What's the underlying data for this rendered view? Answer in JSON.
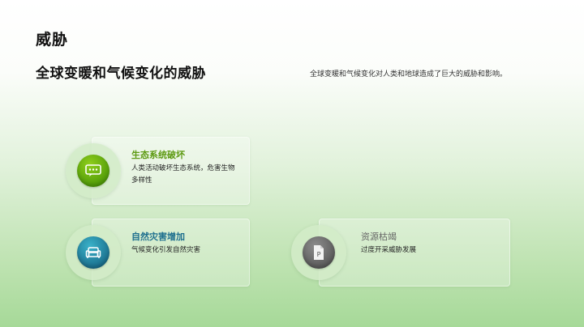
{
  "slide": {
    "section_title": "威胁",
    "headline": "全球变暖和气候变化的威胁",
    "summary": "全球变暖和气候变化对人类和地球造成了巨大的威胁和影响。"
  },
  "cards": [
    {
      "title": "生态系统破坏",
      "description": "人类活动破坏生态系统，危害生物多样性",
      "icon": "chat-bubble-icon",
      "accent": "#6aae10"
    },
    {
      "title": "自然灾害增加",
      "description": "气候变化引发自然灾害",
      "icon": "sofa-icon",
      "accent": "#1e7a9a"
    },
    {
      "title": "资源枯竭",
      "description": "过度开采威胁发展",
      "icon": "document-icon",
      "accent": "#666666"
    }
  ]
}
